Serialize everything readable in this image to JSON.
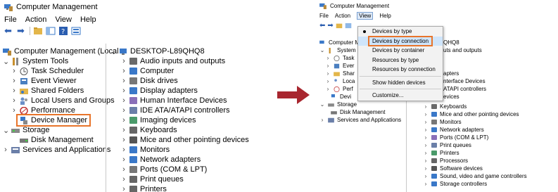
{
  "left": {
    "title": "Computer Management",
    "menu": [
      "File",
      "Action",
      "View",
      "Help"
    ],
    "tree": {
      "root": "Computer Management (Local",
      "items": [
        {
          "label": "System Tools",
          "icon": "tools-icon"
        },
        {
          "label": "Task Scheduler",
          "icon": "clock-icon"
        },
        {
          "label": "Event Viewer",
          "icon": "event-viewer-icon"
        },
        {
          "label": "Shared Folders",
          "icon": "shared-folder-icon"
        },
        {
          "label": "Local Users and Groups",
          "icon": "users-icon"
        },
        {
          "label": "Performance",
          "icon": "performance-icon"
        },
        {
          "label": "Device Manager",
          "icon": "device-manager-icon"
        },
        {
          "label": "Storage",
          "icon": "storage-icon"
        },
        {
          "label": "Disk Management",
          "icon": "disk-icon"
        },
        {
          "label": "Services and Applications",
          "icon": "services-icon"
        }
      ]
    },
    "devices": {
      "root": "DESKTOP-L89QHQ8",
      "items": [
        "Audio inputs and outputs",
        "Computer",
        "Disk drives",
        "Display adapters",
        "Human Interface Devices",
        "IDE ATA/ATAPI controllers",
        "Imaging devices",
        "Keyboards",
        "Mice and other pointing devices",
        "Monitors",
        "Network adapters",
        "Ports (COM & LPT)",
        "Print queues",
        "Printers"
      ]
    }
  },
  "right": {
    "title": "Computer Management",
    "menu": [
      "File",
      "Action",
      "View",
      "Help"
    ],
    "tree_partial": [
      "Computer M",
      "System",
      "Task",
      "Ever",
      "Shar",
      "Loca",
      "Perf",
      "Devi",
      "Storage",
      "Disk Management",
      "Services and Applications"
    ],
    "dev_root_partial": "QHQ8",
    "dev_partial": [
      "uts and outputs",
      "",
      "",
      "apters",
      "nterface Devices",
      "ATAPI controllers",
      "evices"
    ],
    "devices": [
      "Keyboards",
      "Mice and other pointing devices",
      "Monitors",
      "Network adapters",
      "Ports (COM & LPT)",
      "Print queues",
      "Printers",
      "Processors",
      "Software devices",
      "Sound, video and game controllers",
      "Storage controllers"
    ],
    "view_menu": [
      "Devices by type",
      "Devices by connection",
      "Devices by container",
      "Resources by type",
      "Resources by connection",
      "Show hidden devices",
      "Customize..."
    ]
  },
  "colors": {
    "highlight": "#e8742a",
    "arrow": "#a8262f",
    "menu_sel": "#cfe5fb"
  }
}
